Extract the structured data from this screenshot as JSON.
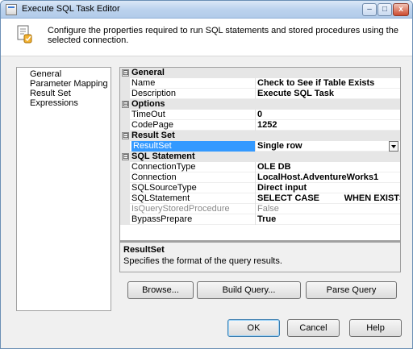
{
  "window": {
    "title": "Execute SQL Task Editor",
    "controls": {
      "minimize": "–",
      "maximize": "□",
      "close": "x"
    }
  },
  "header": {
    "description": "Configure the properties required to run SQL statements and stored procedures using the selected connection."
  },
  "nav": {
    "items": [
      "General",
      "Parameter Mapping",
      "Result Set",
      "Expressions"
    ]
  },
  "properties": {
    "categories": [
      {
        "name": "General",
        "toggle": "⊟",
        "rows": [
          {
            "key": "Name",
            "value": "Check to See if Table Exists"
          },
          {
            "key": "Description",
            "value": "Execute SQL Task"
          }
        ]
      },
      {
        "name": "Options",
        "toggle": "⊟",
        "rows": [
          {
            "key": "TimeOut",
            "value": "0"
          },
          {
            "key": "CodePage",
            "value": "1252"
          }
        ]
      },
      {
        "name": "Result Set",
        "toggle": "⊟",
        "rows": [
          {
            "key": "ResultSet",
            "value": "Single row",
            "selected": true
          }
        ]
      },
      {
        "name": "SQL Statement",
        "toggle": "⊟",
        "rows": [
          {
            "key": "ConnectionType",
            "value": "OLE DB"
          },
          {
            "key": "Connection",
            "value": "LocalHost.AdventureWorks1"
          },
          {
            "key": "SQLSourceType",
            "value": "Direct input"
          },
          {
            "key": "SQLStatement",
            "value": "SELECT CASE          WHEN EXISTS (SELECT tab"
          },
          {
            "key": "IsQueryStoredProcedure",
            "value": "False",
            "disabled": true
          },
          {
            "key": "BypassPrepare",
            "value": "True"
          }
        ]
      }
    ]
  },
  "description_panel": {
    "title": "ResultSet",
    "text": "Specifies the format of the query results."
  },
  "buttons": {
    "browse": "Browse...",
    "build_query": "Build Query...",
    "parse_query": "Parse Query",
    "ok": "OK",
    "cancel": "Cancel",
    "help": "Help"
  }
}
